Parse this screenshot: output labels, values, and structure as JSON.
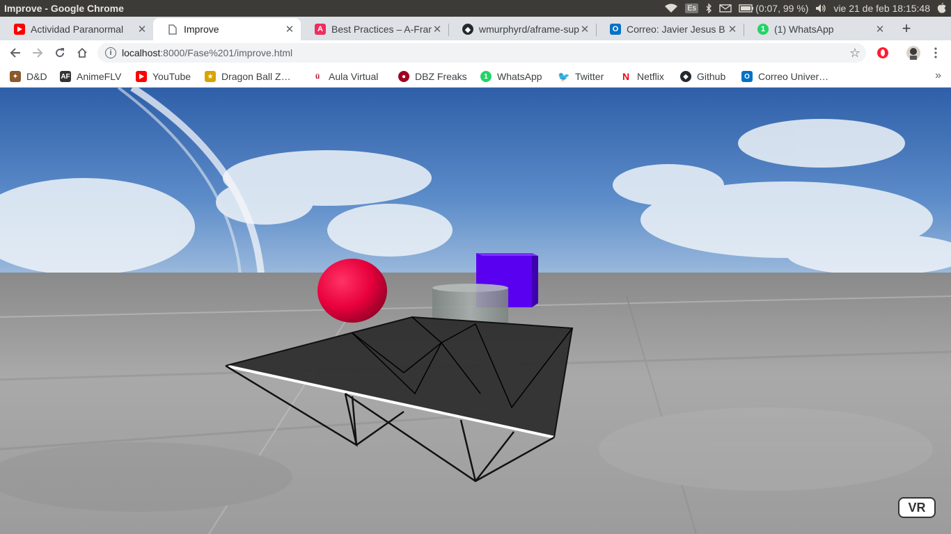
{
  "os": {
    "window_title": "Improve - Google Chrome",
    "keyboard_layout": "Es",
    "battery": "(0:07, 99 %)",
    "datetime": "vie 21 de feb 18:15:48"
  },
  "tabs": [
    {
      "title": "Actividad Paranormal",
      "icon": "youtube-icon",
      "color": "#ff0000"
    },
    {
      "title": "Improve",
      "icon": "page-icon",
      "color": "#5f6368",
      "active": true
    },
    {
      "title": "Best Practices – A-Frame",
      "icon": "aframe-icon",
      "color": "#ef2d5e"
    },
    {
      "title": "wmurphyrd/aframe-super-hands",
      "icon": "github-icon",
      "color": "#24292e"
    },
    {
      "title": "Correo: Javier Jesus B",
      "icon": "outlook-icon",
      "color": "#0072c6"
    },
    {
      "title": "(1) WhatsApp",
      "icon": "whatsapp-icon",
      "color": "#25d366"
    }
  ],
  "toolbar": {
    "url_host": "localhost",
    "url_path": ":8000/Fase%201/improve.html"
  },
  "bookmarks": [
    {
      "label": "D&D",
      "icon": "dnd-icon",
      "color": "#8b5a2b"
    },
    {
      "label": "AnimeFLV",
      "icon": "animeflv-icon",
      "color": "#333333"
    },
    {
      "label": "YouTube",
      "icon": "youtube-icon",
      "color": "#ff0000"
    },
    {
      "label": "Dragon Ball Z…",
      "icon": "dragonball-icon",
      "color": "#d9a400"
    },
    {
      "label": "Aula Virtual",
      "icon": "aula-icon",
      "color": "#b00020"
    },
    {
      "label": "DBZ Freaks",
      "icon": "dbzfreaks-icon",
      "color": "#a00020"
    },
    {
      "label": "WhatsApp",
      "icon": "whatsapp-icon",
      "color": "#25d366"
    },
    {
      "label": "Twitter",
      "icon": "twitter-icon",
      "color": "#1da1f2"
    },
    {
      "label": "Netflix",
      "icon": "netflix-icon",
      "color": "#e50914"
    },
    {
      "label": "Github",
      "icon": "github-icon",
      "color": "#24292e"
    },
    {
      "label": "Correo Univer…",
      "icon": "outlook-icon",
      "color": "#0072c6"
    }
  ],
  "scene": {
    "vr_label": "VR",
    "sphere_color": "#e8003c",
    "box_color": "#5a00f0",
    "cylinder_color": "#9aa3a0",
    "table_color": "#2a2a2a"
  }
}
